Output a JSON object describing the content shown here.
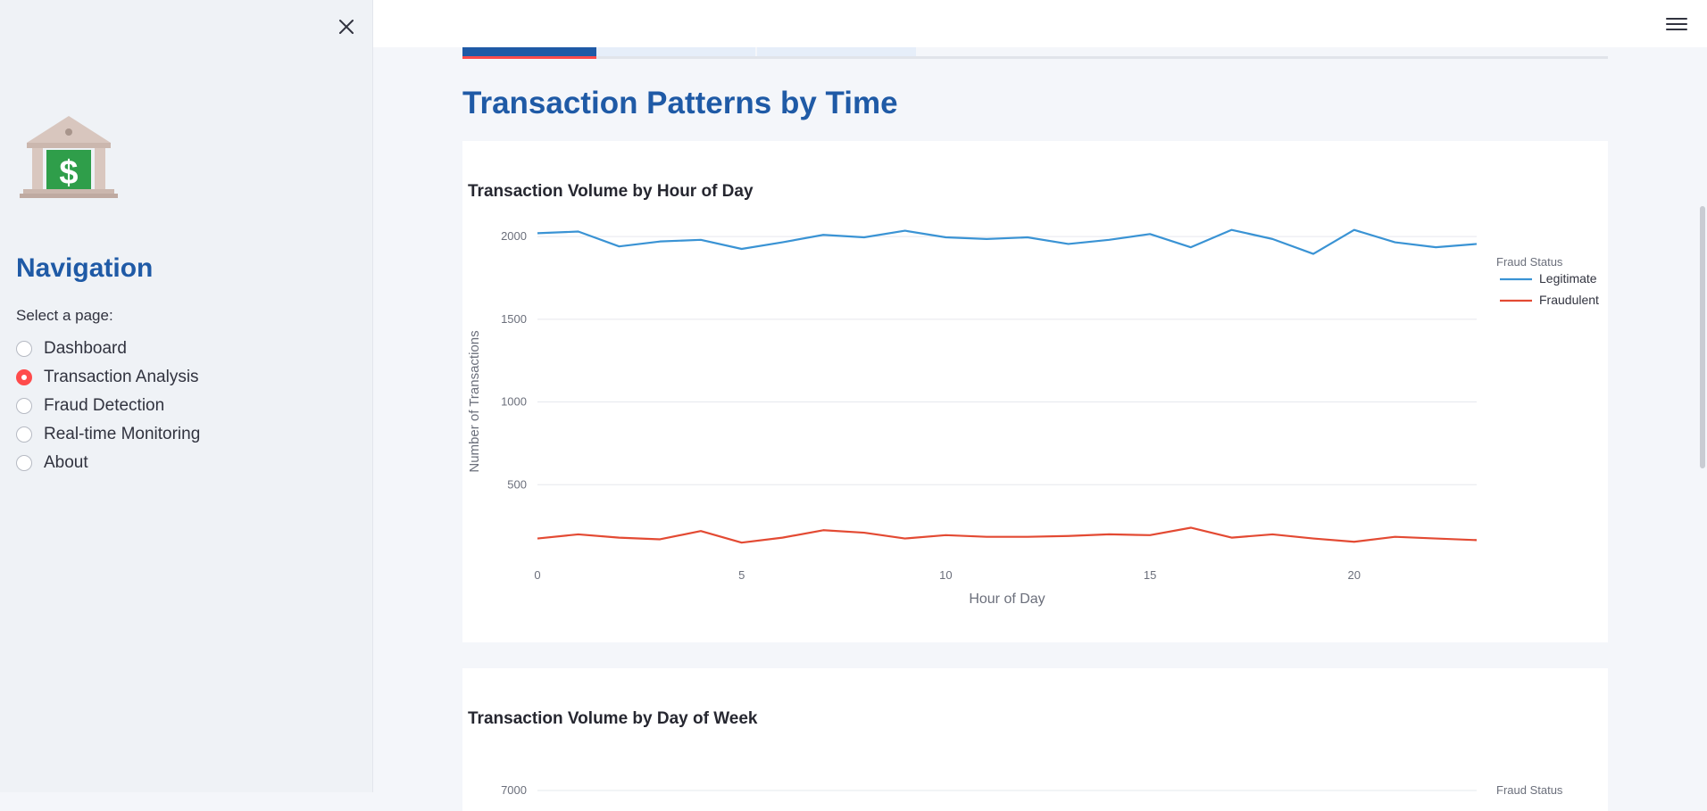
{
  "sidebar": {
    "close_icon": "close-icon",
    "logo_icon": "bank-dollar-icon",
    "title": "Navigation",
    "select_label": "Select a page:",
    "pages": [
      {
        "label": "Dashboard",
        "selected": false
      },
      {
        "label": "Transaction Analysis",
        "selected": true
      },
      {
        "label": "Fraud Detection",
        "selected": false
      },
      {
        "label": "Real-time Monitoring",
        "selected": false
      },
      {
        "label": "About",
        "selected": false
      }
    ]
  },
  "header": {
    "menu_icon": "hamburger-menu-icon"
  },
  "main": {
    "title": "Transaction Patterns by Time",
    "tabs": [
      {
        "selected": true
      },
      {
        "selected": false
      },
      {
        "selected": false
      }
    ]
  },
  "colors": {
    "accent": "#1f5aa6",
    "radio_selected": "#ff4b4b",
    "legitimate": "#3a93d4",
    "fraudulent": "#e34a33"
  },
  "chart_data": [
    {
      "type": "line",
      "title": "Transaction Volume by Hour of Day",
      "xlabel": "Hour of Day",
      "ylabel": "Number of Transactions",
      "x": [
        0,
        1,
        2,
        3,
        4,
        5,
        6,
        7,
        8,
        9,
        10,
        11,
        12,
        13,
        14,
        15,
        16,
        17,
        18,
        19,
        20,
        21,
        22,
        23
      ],
      "xticks": [
        0,
        5,
        10,
        15,
        20
      ],
      "xlim": [
        0,
        23
      ],
      "yticks": [
        500,
        1000,
        1500,
        2000
      ],
      "ylim": [
        0,
        2200
      ],
      "grid": true,
      "legend_title": "Fraud Status",
      "legend_position": "top-right",
      "series": [
        {
          "name": "Legitimate",
          "color": "#3a93d4",
          "values": [
            2020,
            2030,
            1940,
            1970,
            1980,
            1925,
            1965,
            2010,
            1995,
            2035,
            1995,
            1985,
            1995,
            1955,
            1980,
            2015,
            1935,
            2040,
            1985,
            1895,
            2040,
            1965,
            1935,
            1955
          ]
        },
        {
          "name": "Fraudulent",
          "color": "#e34a33",
          "values": [
            175,
            200,
            180,
            170,
            220,
            150,
            180,
            225,
            210,
            175,
            195,
            185,
            185,
            190,
            200,
            195,
            240,
            180,
            200,
            175,
            155,
            185,
            175,
            165
          ]
        }
      ]
    },
    {
      "type": "line",
      "title": "Transaction Volume by Day of Week",
      "yticks": [
        7000
      ],
      "legend_title": "Fraud Status",
      "legend_position": "top-right",
      "series": []
    }
  ]
}
